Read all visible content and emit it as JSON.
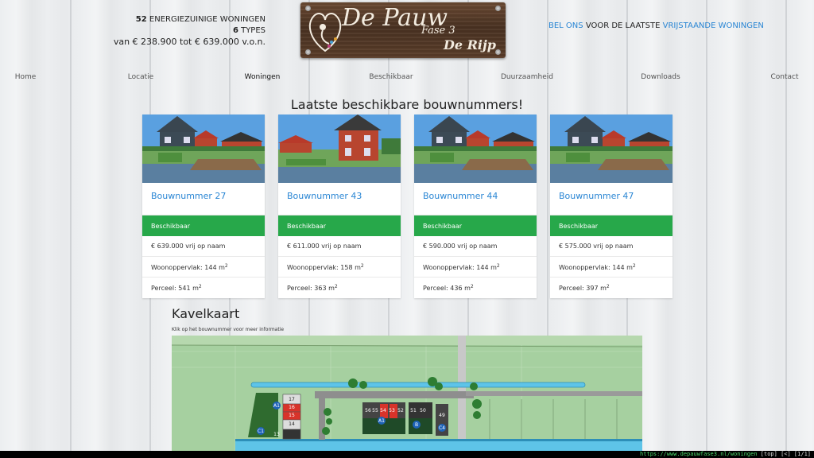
{
  "header": {
    "count_number": "52",
    "count_text": " ENERGIEZUINIGE WONINGEN",
    "types_number": "6",
    "types_text": " TYPES",
    "price_range": "van € 238.900 tot € 639.000 v.o.n.",
    "logo": {
      "title": "De Pauw",
      "subtitle": "Fase 3",
      "location": "De Rijp"
    },
    "call_link": "BEL ONS",
    "call_mid": " VOOR DE LAATSTE ",
    "call_link2": "VRIJSTAANDE WONINGEN"
  },
  "nav": {
    "items": [
      "Home",
      "Locatie",
      "Woningen",
      "Beschikbaar",
      "Duurzaamheid",
      "Downloads",
      "Contact"
    ],
    "active": "Woningen"
  },
  "section_title": "Laatste beschikbare bouwnummers!",
  "cards": [
    {
      "title": "Bouwnummer 27",
      "status": "Beschikbaar",
      "price": "€ 639.000 vrij op naam",
      "woon_label": "Woonoppervlak: 144 m",
      "perceel_label": "Perceel: 541 m"
    },
    {
      "title": "Bouwnummer 43",
      "status": "Beschikbaar",
      "price": "€ 611.000 vrij op naam",
      "woon_label": "Woonoppervlak: 158 m",
      "perceel_label": "Perceel: 363 m"
    },
    {
      "title": "Bouwnummer 44",
      "status": "Beschikbaar",
      "price": "€ 590.000 vrij op naam",
      "woon_label": "Woonoppervlak: 144 m",
      "perceel_label": "Perceel: 436 m"
    },
    {
      "title": "Bouwnummer 47",
      "status": "Beschikbaar",
      "price": "€ 575.000 vrij op naam",
      "woon_label": "Woonoppervlak: 144 m",
      "perceel_label": "Perceel: 397 m"
    }
  ],
  "superscript": "2",
  "kavelkaart": {
    "title": "Kavelkaart",
    "subtitle": "Klik op het bouwnummer voor meer informatie",
    "plots": [
      "17",
      "16",
      "15",
      "14",
      "13",
      "A1",
      "C1",
      "56",
      "55",
      "54",
      "53",
      "52",
      "A1",
      "51",
      "50",
      "B",
      "49",
      "C4"
    ]
  },
  "statusbar": {
    "url": "https://www.depauwfase3.nl/woningen",
    "suffix": " [top] [<] [1/1]"
  },
  "colors": {
    "accent": "#2a86d4",
    "status_green": "#27a84a"
  }
}
